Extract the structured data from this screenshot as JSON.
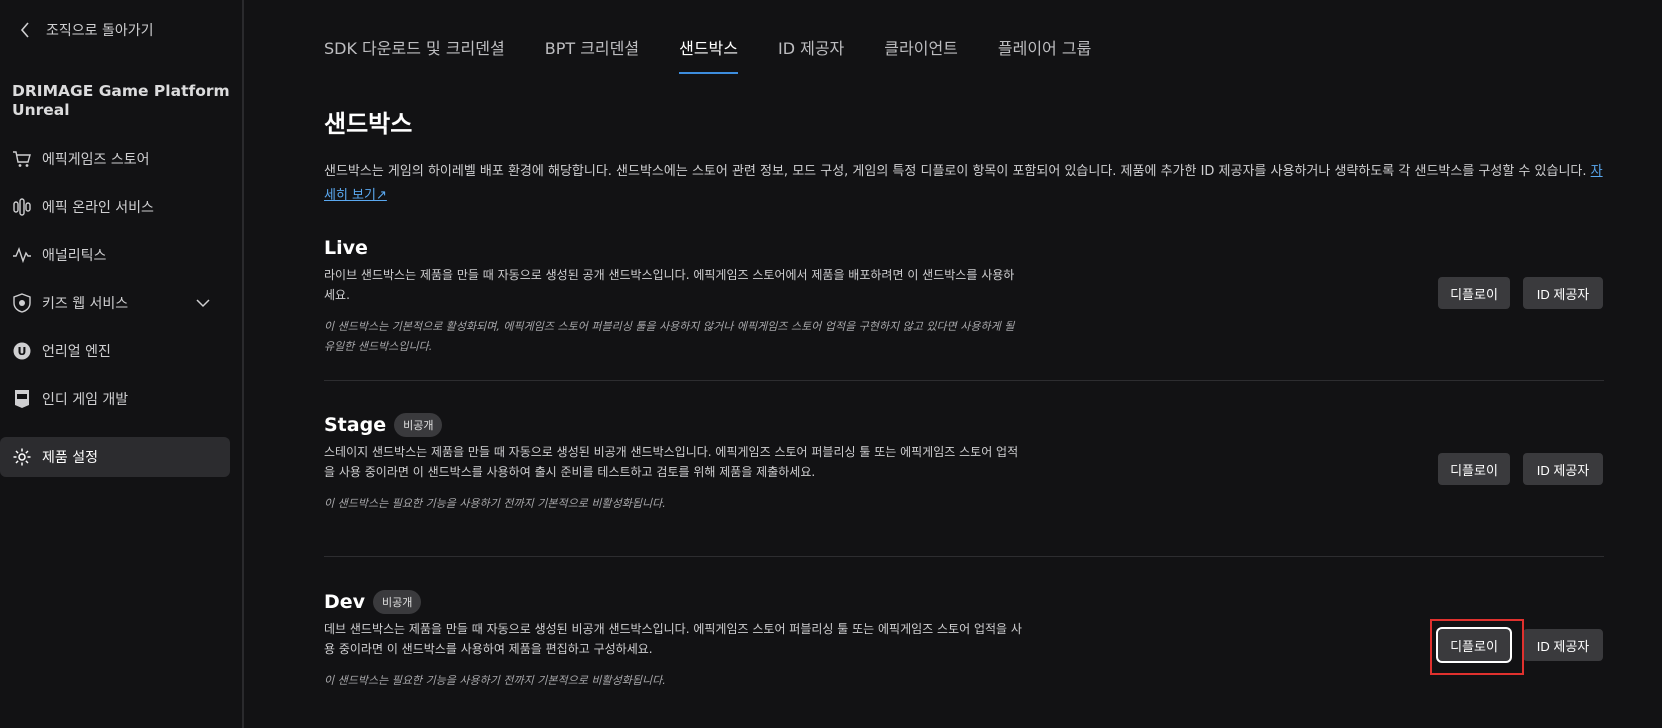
{
  "sidebar": {
    "back_label": "조직으로 돌아가기",
    "project_title": "DRIMAGE Game Platform Unreal",
    "items": [
      {
        "label": "에픽게임즈 스토어",
        "icon": "cart-icon"
      },
      {
        "label": "에픽 온라인 서비스",
        "icon": "services-icon"
      },
      {
        "label": "애널리틱스",
        "icon": "analytics-icon"
      },
      {
        "label": "키즈 웹 서비스",
        "icon": "shield-icon"
      },
      {
        "label": "언리얼 엔진",
        "icon": "unreal-icon"
      },
      {
        "label": "인디 게임 개발",
        "icon": "epic-icon"
      },
      {
        "label": "제품 설정",
        "icon": "gear-icon",
        "active": true
      }
    ]
  },
  "tabs": [
    {
      "label": "SDK 다운로드 및 크리덴셜"
    },
    {
      "label": "BPT 크리덴셜"
    },
    {
      "label": "샌드박스",
      "active": true
    },
    {
      "label": "ID 제공자"
    },
    {
      "label": "클라이언트"
    },
    {
      "label": "플레이어 그룹"
    }
  ],
  "main": {
    "title": "샌드박스",
    "intro_text": "샌드박스는 게임의 하이레벨 배포 환경에 해당합니다. 샌드박스에는 스토어 관련 정보, 모드 구성, 게임의 특정 디플로이 항목이 포함되어 있습니다. 제품에 추가한 ID 제공자를 사용하거나 생략하도록 각 샌드박스를 구성할 수 있습니다.",
    "learn_more": "자세히 보기↗"
  },
  "sandboxes": [
    {
      "name": "Live",
      "badge": "",
      "description": "라이브 샌드박스는 제품을 만들 때 자동으로 생성된 공개 샌드박스입니다. 에픽게임즈 스토어에서 제품을 배포하려면 이 샌드박스를 사용하세요.",
      "note": "이 샌드박스는 기본적으로 활성화되며, 에픽게임즈 스토어 퍼블리싱 툴을 사용하지 않거나 에픽게임즈 스토어 업적을 구현하지 않고 있다면 사용하게 될 유일한 샌드박스입니다.",
      "deploy_label": "디플로이",
      "idp_label": "ID 제공자"
    },
    {
      "name": "Stage",
      "badge": "비공개",
      "description": "스테이지 샌드박스는 제품을 만들 때 자동으로 생성된 비공개 샌드박스입니다. 에픽게임즈 스토어 퍼블리싱 툴 또는 에픽게임즈 스토어 업적을 사용 중이라면 이 샌드박스를 사용하여 출시 준비를 테스트하고 검토를 위해 제품을 제출하세요.",
      "note": "이 샌드박스는 필요한 기능을 사용하기 전까지 기본적으로 비활성화됩니다.",
      "deploy_label": "디플로이",
      "idp_label": "ID 제공자"
    },
    {
      "name": "Dev",
      "badge": "비공개",
      "description": "데브 샌드박스는 제품을 만들 때 자동으로 생성된 비공개 샌드박스입니다. 에픽게임즈 스토어 퍼블리싱 툴 또는 에픽게임즈 스토어 업적을 사용 중이라면 이 샌드박스를 사용하여 제품을 편집하고 구성하세요.",
      "note": "이 샌드박스는 필요한 기능을 사용하기 전까지 기본적으로 비활성화됩니다.",
      "deploy_label": "디플로이",
      "idp_label": "ID 제공자"
    }
  ],
  "colors": {
    "background": "#121214",
    "accent": "#3d8dde",
    "button": "#3a3a3d",
    "highlight": "#e0312e"
  }
}
